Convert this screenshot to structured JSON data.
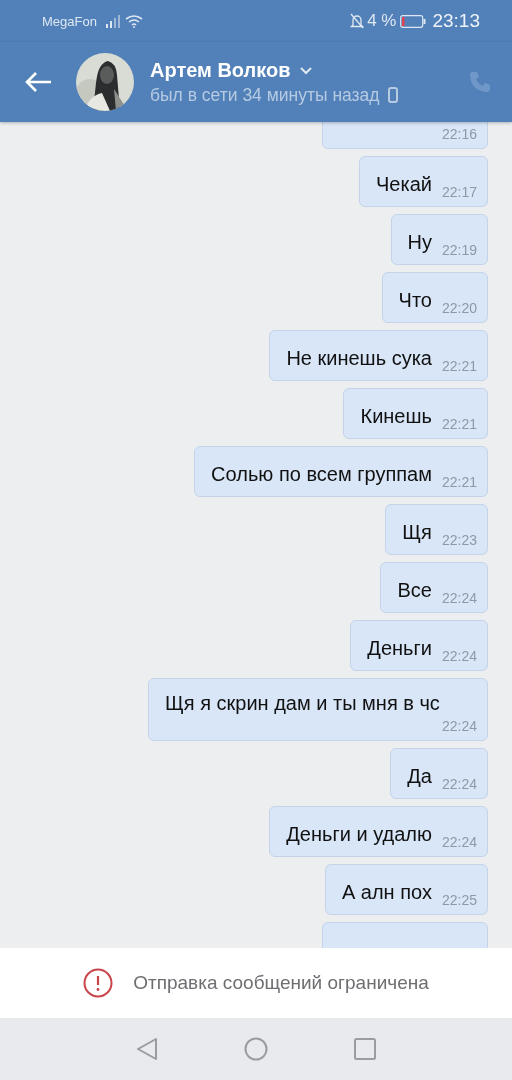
{
  "status_bar": {
    "carrier": "MegaFon",
    "battery": "4 %",
    "time": "23:13"
  },
  "header": {
    "name": "Артем Волков",
    "subtitle": "был в сети 34 минуты назад"
  },
  "messages": [
    {
      "kind": "clipped",
      "time": "22:16"
    },
    {
      "text": "Чекай",
      "time": "22:17"
    },
    {
      "text": "Ну",
      "time": "22:19"
    },
    {
      "text": "Что",
      "time": "22:20"
    },
    {
      "text": "Не кинешь сука",
      "time": "22:21"
    },
    {
      "text": "Кинешь",
      "time": "22:21"
    },
    {
      "text": "Солью по всем группам",
      "time": "22:21"
    },
    {
      "text": "Щя",
      "time": "22:23"
    },
    {
      "text": "Все",
      "time": "22:24"
    },
    {
      "text": "Деньги",
      "time": "22:24"
    },
    {
      "text": "Щя я скрин дам и ты мня в чс",
      "time": "22:24"
    },
    {
      "text": "Да",
      "time": "22:24"
    },
    {
      "text": "Деньги и удалю",
      "time": "22:24"
    },
    {
      "text": "А алн пох",
      "time": "22:25"
    },
    {
      "kind": "clipped"
    }
  ],
  "notice": "Отправка сообщений ограничена"
}
